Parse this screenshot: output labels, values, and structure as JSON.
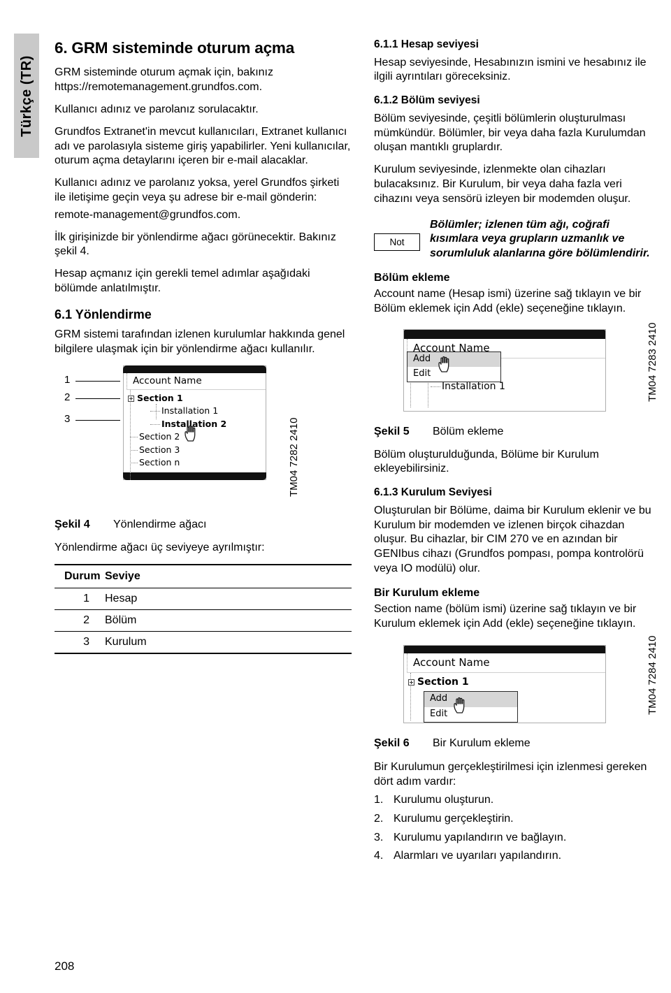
{
  "sidebar": {
    "language_tab": "Türkçe (TR)"
  },
  "page_number": "208",
  "left_column": {
    "heading": "6. GRM sisteminde oturum açma",
    "paragraphs": [
      "GRM sisteminde oturum açmak için, bakınız https://remotemanagement.grundfos.com.",
      "Kullanıcı adınız ve parolanız sorulacaktır.",
      "Grundfos Extranet'in mevcut kullanıcıları, Extranet kullanıcı adı ve parolasıyla sisteme giriş yapabilirler. Yeni kullanıcılar, oturum açma detaylarını içeren bir e-mail alacaklar.",
      "Kullanıcı adınız ve parolanız yoksa, yerel Grundfos şirketi ile iletişime geçin veya şu adrese bir e-mail gönderin:",
      "remote-management@grundfos.com.",
      "İlk girişinizde bir yönlendirme ağacı görünecektir. Bakınız şekil 4.",
      "Hesap açmanız için gerekli temel adımlar aşağıdaki bölümde anlatılmıştır."
    ],
    "subheading_61": "6.1 Yönlendirme",
    "para_61": "GRM sistemi tarafından izlenen kurulumlar hakkında genel bilgilere ulaşmak için bir yönlendirme ağacı kullanılır.",
    "figure4": {
      "tm_code": "TM04 7282 2410",
      "callouts": [
        "1",
        "2",
        "3"
      ],
      "account_label": "Account Name",
      "nodes": [
        {
          "label": "Section 1",
          "level": 1,
          "bold": true,
          "expander": true
        },
        {
          "label": "Installation 1",
          "level": 2,
          "bold": false,
          "expander": false
        },
        {
          "label": "Installation 2",
          "level": 2,
          "bold": true,
          "expander": false
        },
        {
          "label": "Section 2",
          "level": 1,
          "bold": false,
          "expander": false
        },
        {
          "label": "Section 3",
          "level": 1,
          "bold": false,
          "expander": false
        },
        {
          "label": "Section n",
          "level": 1,
          "bold": false,
          "expander": false
        }
      ],
      "caption_id": "Şekil 4",
      "caption_text": "Yönlendirme ağacı"
    },
    "table_intro": "Yönlendirme ağacı üç seviyeye ayrılmıştır:",
    "table": {
      "headers": [
        "Durum",
        "Seviye"
      ],
      "rows": [
        {
          "durum": "1",
          "seviye": "Hesap"
        },
        {
          "durum": "2",
          "seviye": "Bölüm"
        },
        {
          "durum": "3",
          "seviye": "Kurulum"
        }
      ]
    }
  },
  "right_column": {
    "heading_611": "6.1.1 Hesap seviyesi",
    "para_611": "Hesap seviyesinde, Hesabınızın ismini ve hesabınız ile ilgili ayrıntıları göreceksiniz.",
    "heading_612": "6.1.2 Bölüm seviyesi",
    "para_612_a": "Bölüm seviyesinde, çeşitli bölümlerin oluşturulması mümkündür. Bölümler, bir veya daha fazla Kurulumdan oluşan mantıklı gruplardır.",
    "para_612_b": "Kurulum seviyesinde, izlenmekte olan cihazları bulacaksınız. Bir Kurulum, bir veya daha fazla veri cihazını veya sensörü izleyen bir modemden oluşur.",
    "note": {
      "badge": "Not",
      "text": "Bölümler; izlenen tüm ağı, coğrafi kısımlara veya grupların uzmanlık ve sorumluluk alanlarına göre bölümlendirir."
    },
    "bolum_ekleme_heading": "Bölüm ekleme",
    "bolum_ekleme_text": "Account name (Hesap ismi) üzerine sağ tıklayın ve bir Bölüm eklemek için Add (ekle) seçeneğine tıklayın.",
    "figure5": {
      "tm_code": "TM04 7283 2410",
      "account_label": "Account Name",
      "menu_items": [
        {
          "label": "Add",
          "selected": true
        },
        {
          "label": "Edit",
          "selected": false
        }
      ],
      "background_node": "Installation 1",
      "caption_id": "Şekil 5",
      "caption_text": "Bölüm ekleme"
    },
    "after_fig5_text": "Bölüm oluşturulduğunda, Bölüme bir Kurulum ekleyebilirsiniz.",
    "heading_613": "6.1.3 Kurulum Seviyesi",
    "para_613": "Oluşturulan bir Bölüme, daima bir Kurulum eklenir ve bu Kurulum bir modemden ve izlenen birçok cihazdan oluşur. Bu cihazlar, bir CIM 270 ve en azından bir GENIbus cihazı (Grundfos pompası, pompa kontrolörü veya IO  modülü) olur.",
    "kurulum_ekleme_heading": "Bir Kurulum ekleme",
    "kurulum_ekleme_text": "Section name (bölüm ismi) üzerine sağ tıklayın ve bir Kurulum eklemek için Add (ekle) seçeneğine tıklayın.",
    "figure6": {
      "tm_code": "TM04 7284 2410",
      "account_label": "Account Name",
      "section_label": "Section 1",
      "menu_items": [
        {
          "label": "Add",
          "selected": true
        },
        {
          "label": "Edit",
          "selected": false
        }
      ],
      "caption_id": "Şekil 6",
      "caption_text": "Bir Kurulum ekleme"
    },
    "steps_intro": "Bir Kurulumun gerçekleştirilmesi için izlenmesi gereken dört adım vardır:",
    "steps": [
      {
        "num": "1.",
        "text": "Kurulumu oluşturun."
      },
      {
        "num": "2.",
        "text": "Kurulumu gerçekleştirin."
      },
      {
        "num": "3.",
        "text": "Kurulumu yapılandırın ve bağlayın."
      },
      {
        "num": "4.",
        "text": "Alarmları ve uyarıları yapılandırın."
      }
    ]
  }
}
